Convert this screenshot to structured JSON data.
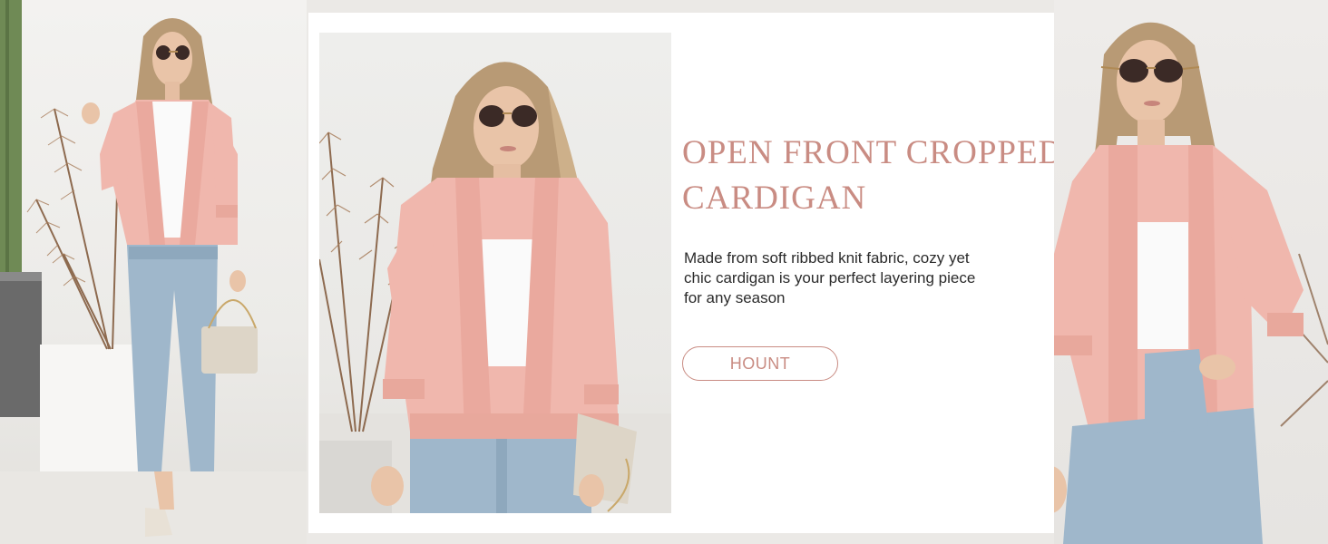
{
  "headline": {
    "line1": "OPEN FRONT CROPPED",
    "line2": "CARDIGAN"
  },
  "description": "Made from soft ribbed knit fabric, cozy yet chic cardigan is your perfect layering piece for any season",
  "brand_button": {
    "label": "HOUNT"
  },
  "colors": {
    "accent": "#c98c83",
    "cardigan": "#f0b7ad",
    "denim": "#9fb7cb",
    "background": "#ebe9e6",
    "card": "#ffffff"
  }
}
